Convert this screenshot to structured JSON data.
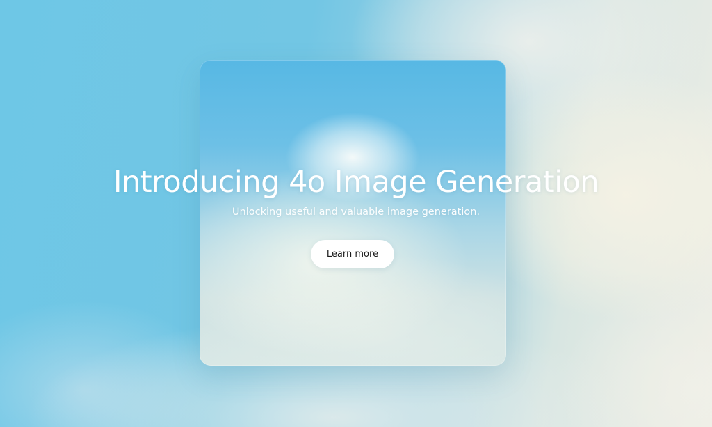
{
  "hero": {
    "title": "Introducing 4o Image Generation",
    "subtitle": "Unlocking useful and valuable image generation.",
    "cta_label": "Learn more"
  },
  "colors": {
    "sky_blue": "#6ec7e6",
    "cloud_cream": "#eeeee6",
    "title_text": "#ffffff",
    "button_bg": "#ffffff",
    "button_text": "#1b1b1b"
  }
}
